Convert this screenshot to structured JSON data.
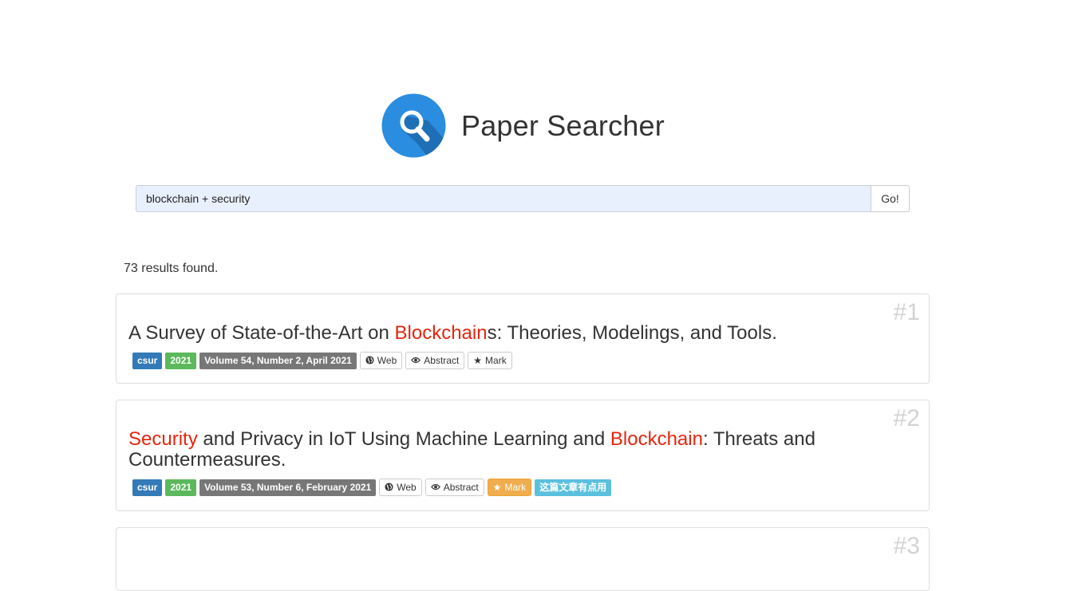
{
  "app": {
    "title": "Paper Searcher"
  },
  "search": {
    "value": "blockchain + security",
    "button_label": "Go!"
  },
  "results": {
    "count_text": "73 results found.",
    "items": [
      {
        "number": "#1",
        "title_parts": [
          {
            "text": "A Survey of State-of-the-Art on ",
            "highlight": false
          },
          {
            "text": "Blockchain",
            "highlight": true
          },
          {
            "text": "s: Theories, Modelings, and Tools.",
            "highlight": false
          }
        ],
        "venue": "csur",
        "year": "2021",
        "volume": "Volume 54, Number 2, April 2021",
        "web_label": "Web",
        "abstract_label": "Abstract",
        "mark_label": "Mark",
        "marked": false
      },
      {
        "number": "#2",
        "title_parts": [
          {
            "text": "Security",
            "highlight": true
          },
          {
            "text": " and Privacy in IoT Using Machine Learning and ",
            "highlight": false
          },
          {
            "text": "Blockchain",
            "highlight": true
          },
          {
            "text": ": Threats and Countermeasures.",
            "highlight": false
          }
        ],
        "venue": "csur",
        "year": "2021",
        "volume": "Volume 53, Number 6, February 2021",
        "web_label": "Web",
        "abstract_label": "Abstract",
        "mark_label": "Mark",
        "marked": true,
        "note": "这篇文章有点用"
      },
      {
        "number": "#3"
      }
    ]
  },
  "colors": {
    "highlight": "#e6250e",
    "venue_badge": "#337ab7",
    "year_badge": "#5cb85c",
    "volume_badge": "#777777",
    "mark_active": "#f0ad4e",
    "note_badge": "#5bc0de",
    "logo_circle": "#2b8de0"
  },
  "icons": {
    "logo": "magnifier-icon",
    "web": "globe-icon",
    "abstract": "eye-icon",
    "mark": "star-icon"
  }
}
